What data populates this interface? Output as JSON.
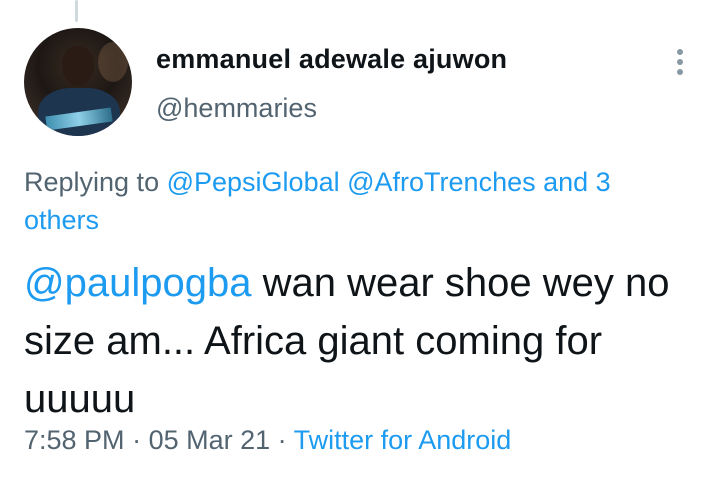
{
  "author": {
    "display_name": "emmanuel adewale ajuwon",
    "handle": "@hemmaries"
  },
  "reply_context": {
    "prefix": "Replying to",
    "mentions": [
      "@PepsiGlobal",
      "@AfroTrenches"
    ],
    "others": "and 3 others"
  },
  "tweet": {
    "mention": "@paulpogba",
    "text": " wan wear shoe wey no size am... Africa giant coming for uuuuu"
  },
  "meta": {
    "time": "7:58 PM",
    "separator1": " · ",
    "date": "05 Mar 21",
    "separator2": " · ",
    "source": "Twitter for Android"
  },
  "icons": {
    "more": "more-vertical-icon"
  },
  "colors": {
    "link": "#1d9bf0",
    "secondary": "#536471",
    "primary": "#0f1419"
  }
}
